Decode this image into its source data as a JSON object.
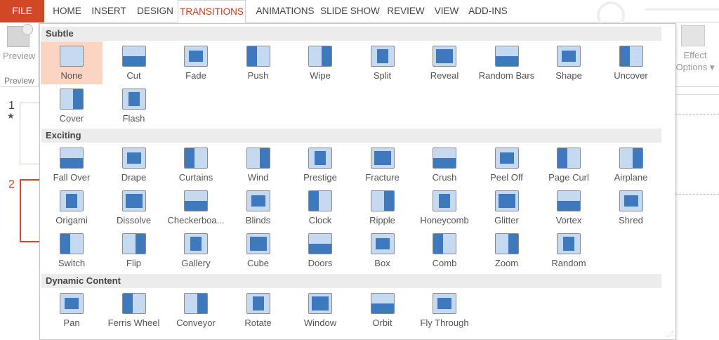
{
  "tabs": [
    "FILE",
    "HOME",
    "INSERT",
    "DESIGN",
    "TRANSITIONS",
    "ANIMATIONS",
    "SLIDE SHOW",
    "REVIEW",
    "VIEW",
    "ADD-INS"
  ],
  "active_tab": "TRANSITIONS",
  "ribbon": {
    "preview_button": "Preview",
    "preview_group": "Preview",
    "effect_options_line1": "Effect",
    "effect_options_line2": "Options"
  },
  "slides": [
    {
      "number": "1",
      "star": "★"
    },
    {
      "number": "2"
    }
  ],
  "colors": {
    "file": "#d24726",
    "accent": "#c43e1c",
    "selected": "#fcd5c2",
    "icon_blue": "#3e78bd"
  },
  "gallery": {
    "sections": [
      {
        "title": "Subtle",
        "items": [
          "None",
          "Cut",
          "Fade",
          "Push",
          "Wipe",
          "Split",
          "Reveal",
          "Random Bars",
          "Shape",
          "Uncover",
          "Cover",
          "Flash"
        ]
      },
      {
        "title": "Exciting",
        "items": [
          "Fall Over",
          "Drape",
          "Curtains",
          "Wind",
          "Prestige",
          "Fracture",
          "Crush",
          "Peel Off",
          "Page Curl",
          "Airplane",
          "Origami",
          "Dissolve",
          "Checkerboa...",
          "Blinds",
          "Clock",
          "Ripple",
          "Honeycomb",
          "Glitter",
          "Vortex",
          "Shred",
          "Switch",
          "Flip",
          "Gallery",
          "Cube",
          "Doors",
          "Box",
          "Comb",
          "Zoom",
          "Random"
        ]
      },
      {
        "title": "Dynamic Content",
        "items": [
          "Pan",
          "Ferris Wheel",
          "Conveyor",
          "Rotate",
          "Window",
          "Orbit",
          "Fly Through"
        ]
      }
    ],
    "selected": "None"
  }
}
